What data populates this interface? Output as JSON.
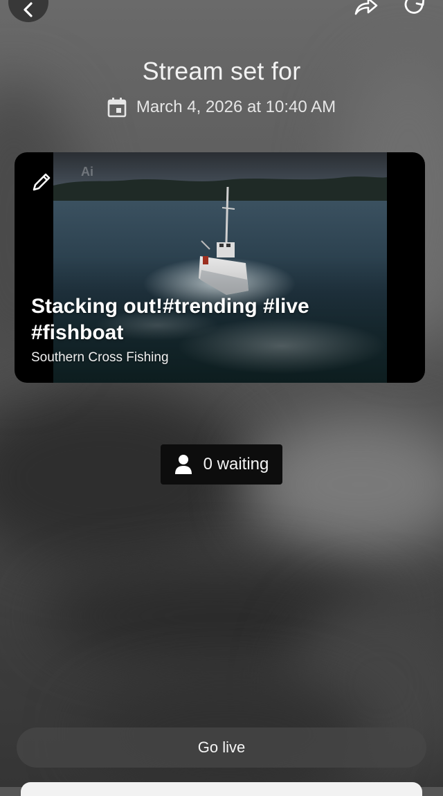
{
  "header": {
    "back_icon": "chevron-left-icon",
    "share_icon": "share-arrow-icon",
    "refresh_icon": "refresh-icon"
  },
  "schedule": {
    "title": "Stream set for",
    "date_icon": "calendar-icon",
    "datetime": "March 4, 2026 at 10:40 AM"
  },
  "stream_card": {
    "edit_icon": "pencil-icon",
    "watermark": "Ai",
    "title_line1": "Stacking out!#trending #live",
    "title_line2": "#fishboat",
    "channel": "Southern Cross Fishing"
  },
  "waiting": {
    "icon": "person-icon",
    "label": "0 waiting"
  },
  "actions": {
    "go_live_label": "Go live"
  },
  "colors": {
    "card_bg": "#000000",
    "waiting_bg": "#0d0d0d",
    "button_bg": "#464646"
  }
}
